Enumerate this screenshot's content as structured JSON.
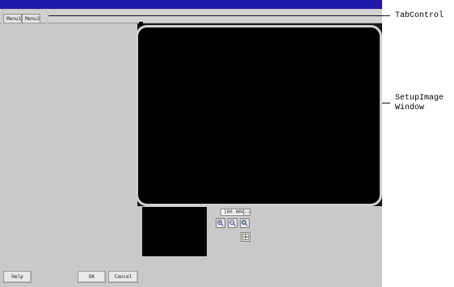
{
  "tabs": [
    {
      "label": "Menu1"
    },
    {
      "label": "Menu2"
    }
  ],
  "image_toolbar": {
    "zoom_value": "100.000",
    "zoom_more": "...",
    "tools": [
      {
        "name": "zoom-in-icon"
      },
      {
        "name": "zoom-out-icon"
      },
      {
        "name": "zoom-fit-icon"
      },
      {
        "name": "fit-grid-icon"
      }
    ]
  },
  "buttons": {
    "help": "Help",
    "ok": "OK",
    "cancel": "Cancel"
  },
  "callouts": {
    "tab_control": "TabControl",
    "setup_image_line1": "SetupImage",
    "setup_image_line2": "Window"
  },
  "colors": {
    "title_bar": "#1f1ba8",
    "panel": "#c9c9c9",
    "image_bg": "#000000"
  }
}
